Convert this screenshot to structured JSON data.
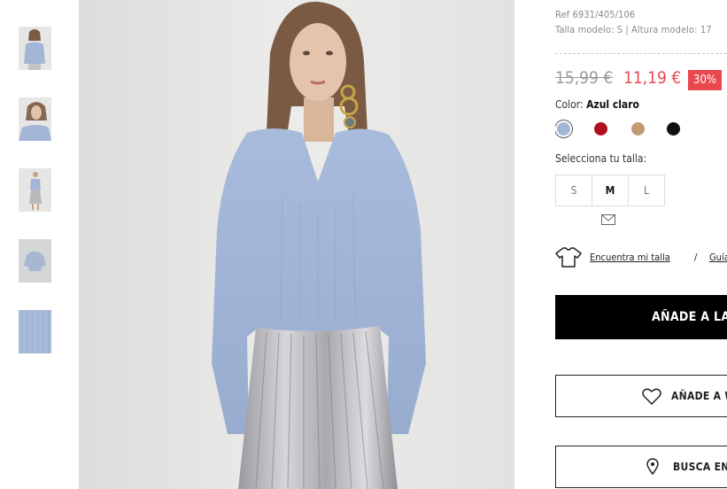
{
  "gallery": {
    "thumbnails": [
      {
        "name": "front"
      },
      {
        "name": "close-up"
      },
      {
        "name": "full-body"
      },
      {
        "name": "flat"
      },
      {
        "name": "fabric"
      }
    ],
    "main_image_alt": "Jersey azul claro con cuello de pico"
  },
  "product": {
    "ref": "Ref 6931/405/106",
    "model_info": "Talla modelo: S | Altura modelo: 17",
    "price_old": "15,99 €",
    "price_new": "11,19 €",
    "discount": "30%",
    "color_prefix": "Color:",
    "color_name": "Azul claro",
    "swatches": [
      {
        "name": "azul-claro",
        "color": "#a3b6d8",
        "selected": true
      },
      {
        "name": "rojo",
        "color": "#b0101b",
        "selected": false
      },
      {
        "name": "camel",
        "color": "#c29a72",
        "selected": false
      },
      {
        "name": "negro",
        "color": "#111111",
        "selected": false
      }
    ],
    "size_label": "Selecciona tu talla:",
    "sizes": [
      "S",
      "M",
      "L"
    ],
    "selected_size": "M"
  },
  "size_help": {
    "find_size": "Encuentra mi talla",
    "separator": "/",
    "guide": "Guía"
  },
  "actions": {
    "add_to_cart": "AÑADE A LA",
    "add_to_wishlist": "AÑADE A W",
    "find_in_store": "BUSCA EN"
  },
  "colors": {
    "accent_red": "#e8494f",
    "black": "#000000"
  }
}
